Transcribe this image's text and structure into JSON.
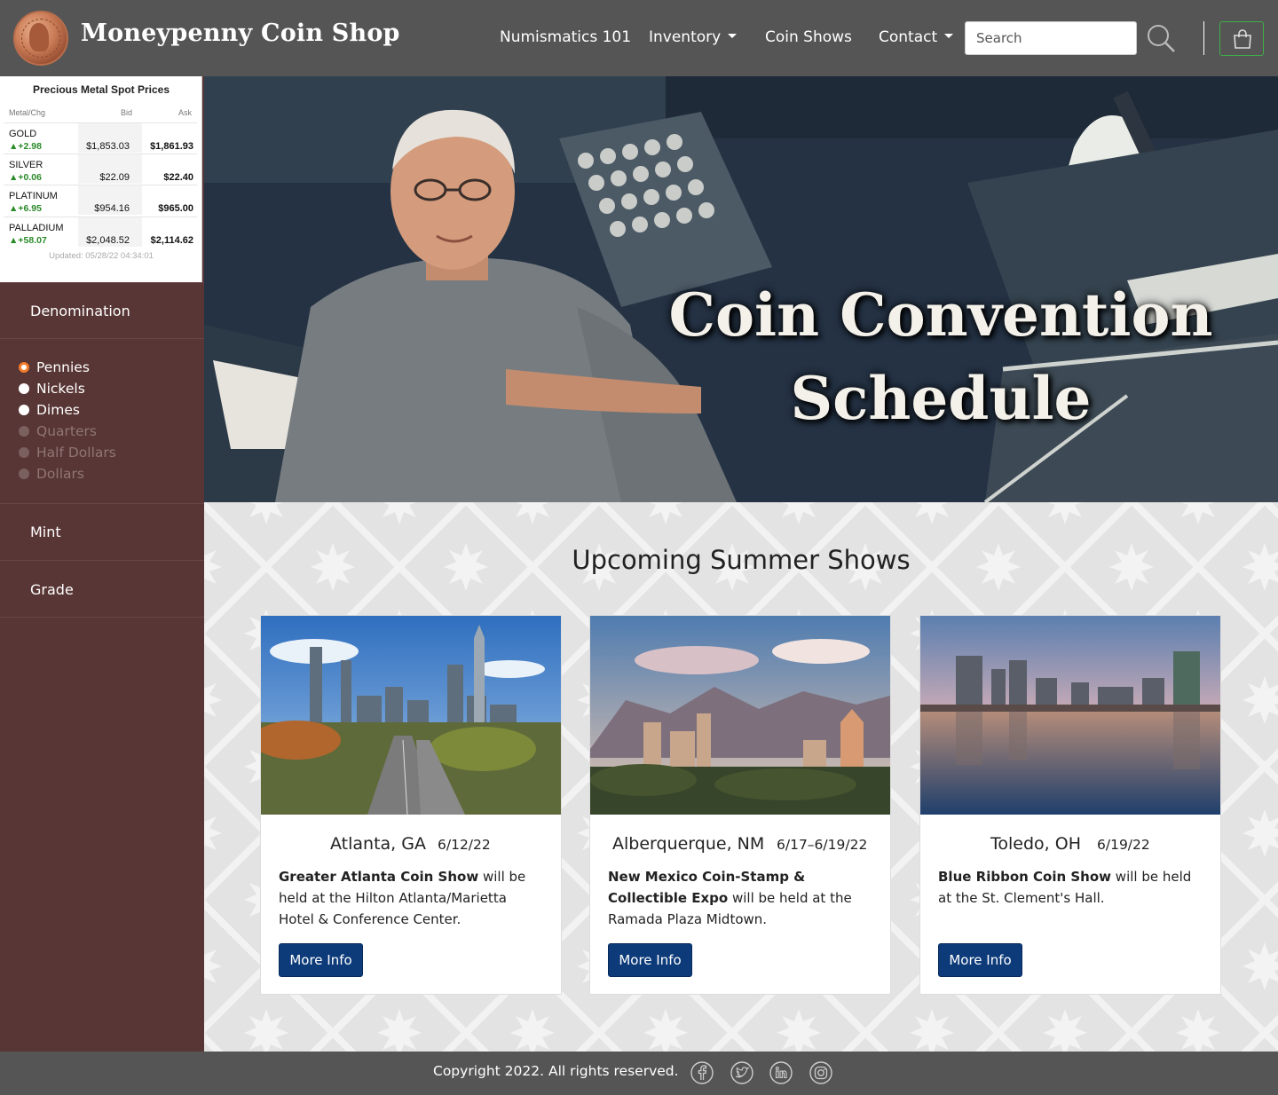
{
  "header": {
    "brand": "Moneypenny Coin Shop",
    "nav": [
      {
        "label": "Numismatics 101"
      },
      {
        "label": "Inventory"
      },
      {
        "label": "Coin Shows"
      },
      {
        "label": "Contact"
      }
    ],
    "search_placeholder": "Search"
  },
  "spot_prices": {
    "title": "Precious Metal Spot Prices",
    "headers": [
      "Metal/Chg",
      "Bid",
      "Ask"
    ],
    "rows": [
      {
        "metal": "GOLD",
        "change": "▲+2.98",
        "bid": "$1,853.03",
        "ask": "$1,861.93"
      },
      {
        "metal": "SILVER",
        "change": "▲+0.06",
        "bid": "$22.09",
        "ask": "$22.40"
      },
      {
        "metal": "PLATINUM",
        "change": "▲+6.95",
        "bid": "$954.16",
        "ask": "$965.00"
      },
      {
        "metal": "PALLADIUM",
        "change": "▲+58.07",
        "bid": "$2,048.52",
        "ask": "$2,114.62"
      }
    ],
    "updated": "Updated: 05/28/22 04:34:01"
  },
  "filters": {
    "denomination": {
      "heading": "Denomination",
      "options": [
        {
          "label": "Pennies",
          "checked": true,
          "enabled": true
        },
        {
          "label": "Nickels",
          "checked": false,
          "enabled": true
        },
        {
          "label": "Dimes",
          "checked": false,
          "enabled": true
        },
        {
          "label": "Quarters",
          "checked": false,
          "enabled": false
        },
        {
          "label": "Half Dollars",
          "checked": false,
          "enabled": false
        },
        {
          "label": "Dollars",
          "checked": false,
          "enabled": false
        }
      ]
    },
    "mint": {
      "heading": "Mint"
    },
    "grade": {
      "heading": "Grade"
    }
  },
  "hero": {
    "title_line1": "Coin Convention",
    "title_line2": "Schedule"
  },
  "main": {
    "section_title": "Upcoming Summer Shows",
    "cards": [
      {
        "city": "Atlanta, GA",
        "date": "6/12/22",
        "show_name": "Greater Atlanta Coin Show",
        "description": " will be held at the Hilton Atlanta/Marietta Hotel & Conference Center.",
        "button": "More Info"
      },
      {
        "city": "Alberquerque, NM",
        "date": "6/17–6/19/22",
        "show_name": "New Mexico Coin-Stamp & Collectible Expo",
        "description": " will be held at the Ramada Plaza Midtown.",
        "button": "More Info"
      },
      {
        "city": "Toledo, OH",
        "date": "6/19/22",
        "show_name": "Blue Ribbon Coin Show",
        "description": " will be held at the St. Clement's Hall.",
        "button": "More Info"
      }
    ]
  },
  "footer": {
    "copyright": "Copyright 2022. All rights reserved.",
    "social": [
      "facebook-icon",
      "twitter-icon",
      "linkedin-icon",
      "instagram-icon"
    ]
  },
  "colors": {
    "header_bg": "#555555",
    "sidebar_bg": "#583635",
    "button_bg": "#0d3b7a",
    "cart_border": "#3fae49",
    "radio_accent": "#f47c2b",
    "price_up": "#2a8a2a"
  }
}
